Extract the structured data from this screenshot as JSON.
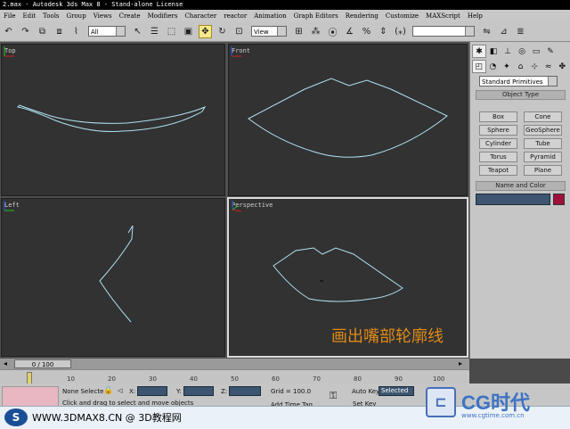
{
  "window": {
    "title": "2.max - Autodesk 3ds Max 8 - Stand-alone License"
  },
  "menu": [
    "File",
    "Edit",
    "Tools",
    "Group",
    "Views",
    "Create",
    "Modifiers",
    "Character",
    "reactor",
    "Animation",
    "Graph Editors",
    "Rendering",
    "Customize",
    "MAXScript",
    "Help"
  ],
  "toolbar": {
    "selection_filter": "All",
    "ref_coord": "View"
  },
  "viewports": {
    "top": "Top",
    "front": "Front",
    "left": "Left",
    "perspective": "Perspective"
  },
  "caption": "画出嘴部轮廓线",
  "command_panel": {
    "dropdown": "Standard Primitives",
    "object_type_title": "Object Type",
    "buttons": [
      "Box",
      "Cone",
      "Sphere",
      "GeoSphere",
      "Cylinder",
      "Tube",
      "Torus",
      "Pyramid",
      "Teapot",
      "Plane"
    ],
    "name_color_title": "Name and Color",
    "color": "#a0103a"
  },
  "timeline": {
    "frame": "0 / 100",
    "ticks": [
      "10",
      "20",
      "30",
      "40",
      "50",
      "60",
      "70",
      "80",
      "90",
      "100"
    ]
  },
  "status": {
    "selection": "None Selecte",
    "prompt": "Click and drag to select and move objects",
    "x_label": "X:",
    "y_label": "Y:",
    "z_label": "Z:",
    "grid": "Grid = 100.0",
    "add_time_tag": "Add Time Tag",
    "auto_key": "Auto Key",
    "set_key": "Set Key",
    "key_mode": "Selected"
  },
  "footer": {
    "text": "WWW.3DMAX8.CN @ 3D教程网"
  },
  "watermark": {
    "text": "CG时代",
    "url": "www.cgtime.com.cn"
  }
}
